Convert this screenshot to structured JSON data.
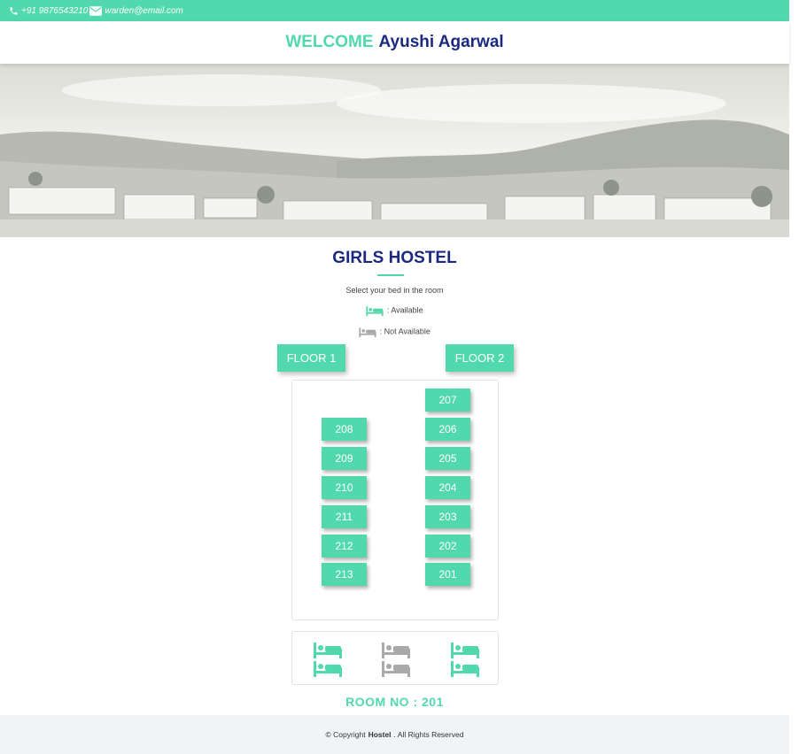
{
  "topbar": {
    "phone": "+91 9876543210",
    "email": "warden@email.com"
  },
  "header": {
    "welcome": "WELCOME",
    "name": "Ayushi Agarwal"
  },
  "page": {
    "title": "GIRLS HOSTEL",
    "subtitle": "Select your bed in the room",
    "legend_available": ": Available",
    "legend_not_available": ": Not Available"
  },
  "floors": {
    "floor1": "FLOOR 1",
    "floor2": "FLOOR 2"
  },
  "rooms": {
    "left": [
      "208",
      "209",
      "210",
      "211",
      "212",
      "213"
    ],
    "right": [
      "207",
      "206",
      "205",
      "204",
      "203",
      "202",
      "201"
    ]
  },
  "beds": [
    {
      "status": "available"
    },
    {
      "status": "not-available"
    },
    {
      "status": "available"
    },
    {
      "status": "available"
    },
    {
      "status": "not-available"
    },
    {
      "status": "available"
    }
  ],
  "room_label": "ROOM NO : 201",
  "footer": {
    "pre": "© Copyright",
    "brand": "Hostel",
    "post": ". All Rights Reserved"
  },
  "colors": {
    "accent": "#52d8ad",
    "navy": "#1b2a80",
    "unavailable": "#a9a9a9"
  },
  "icons": {
    "phone": "phone-icon",
    "email": "envelope-icon",
    "bed": "bed-icon"
  }
}
